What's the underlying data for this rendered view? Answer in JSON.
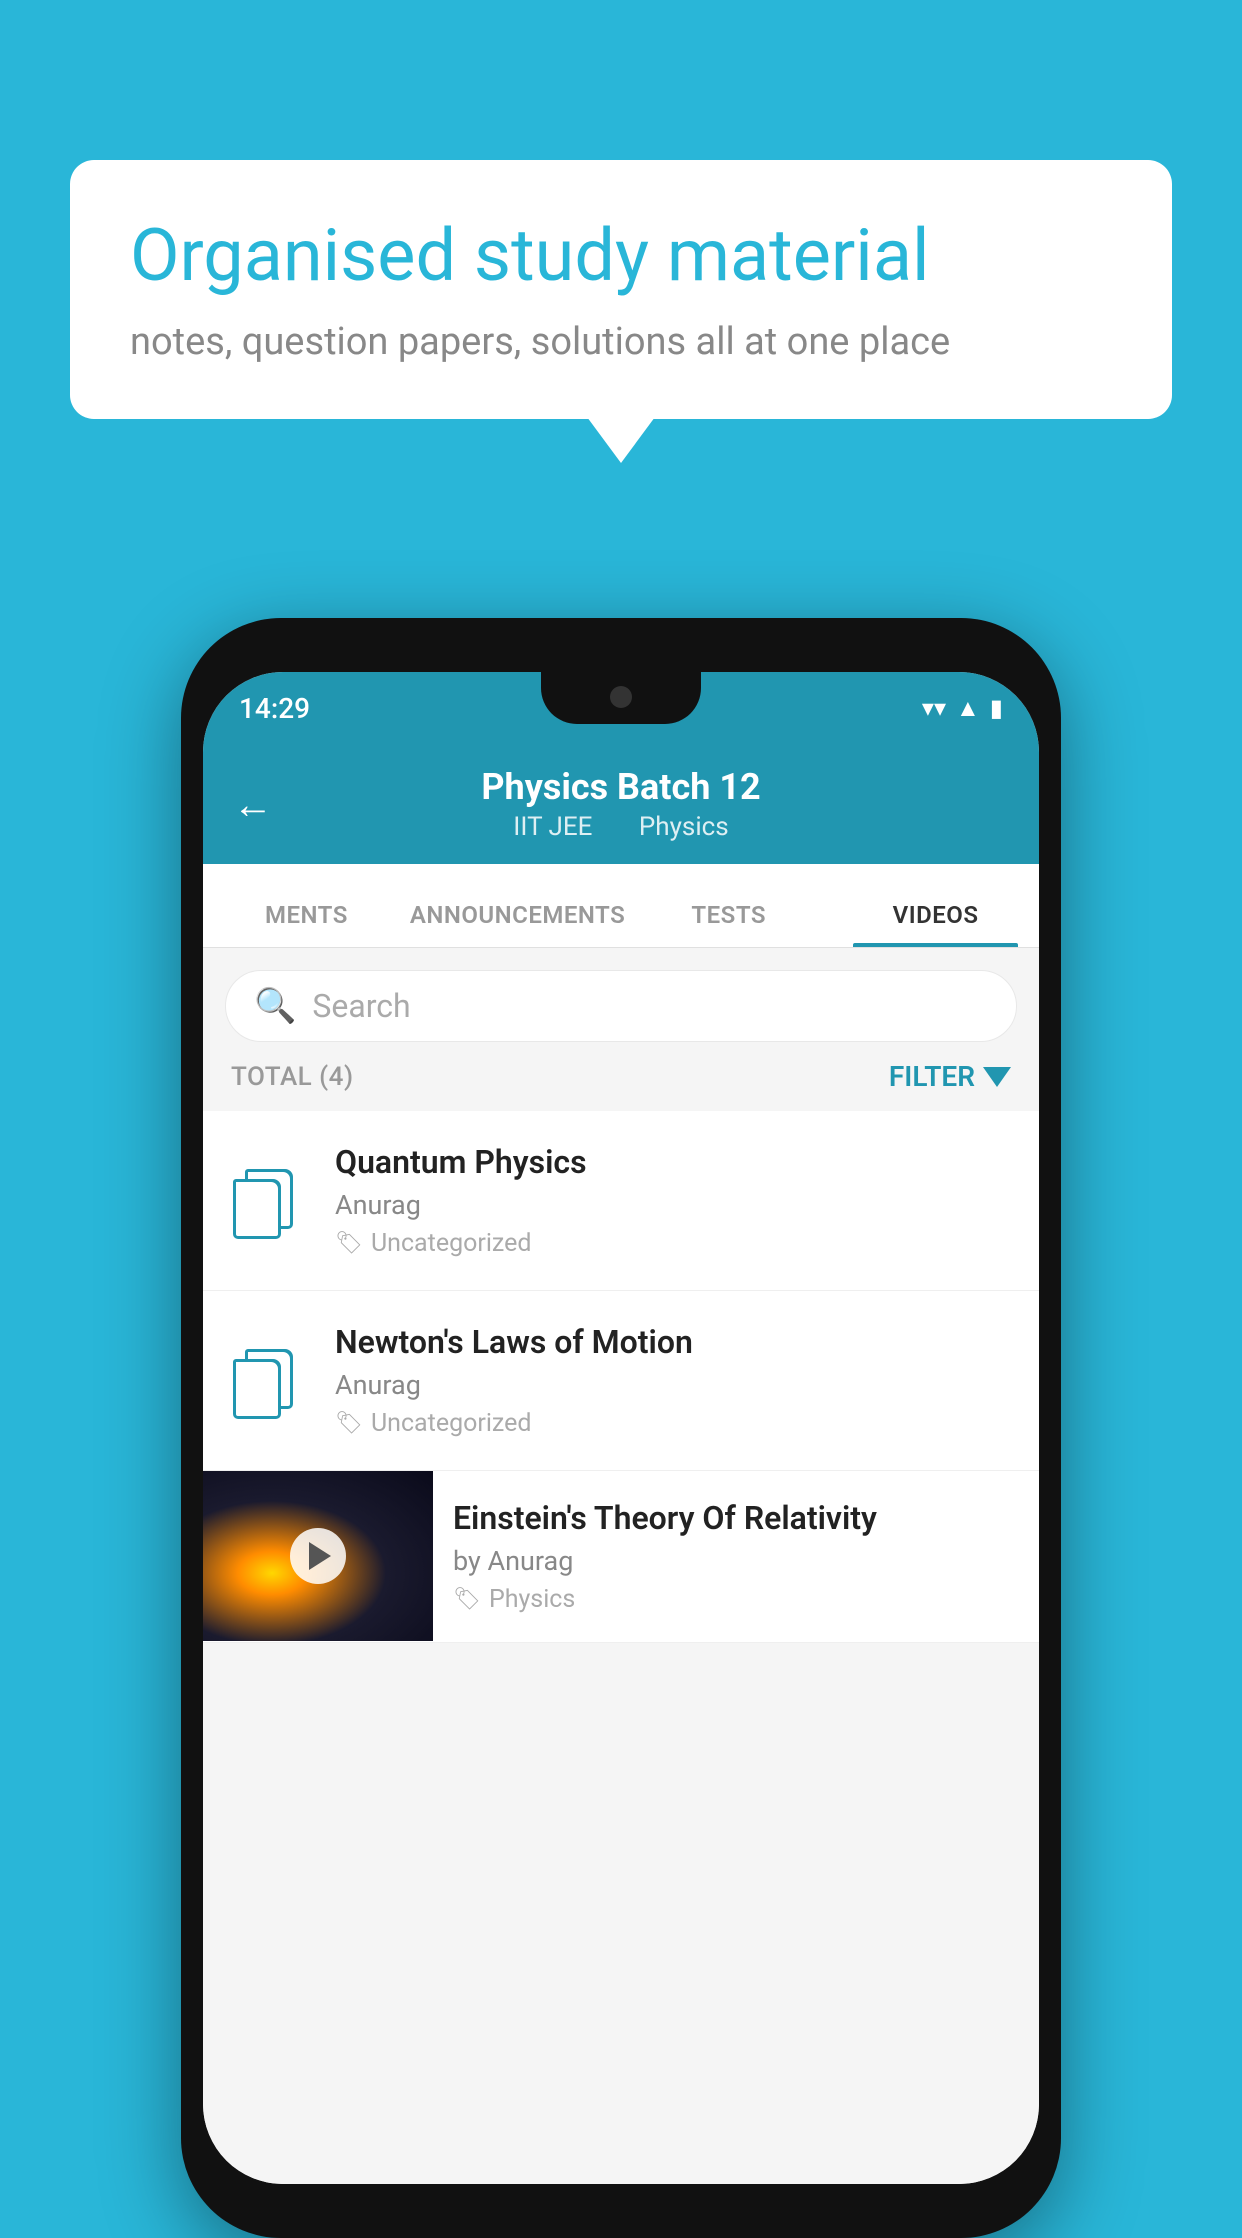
{
  "background_color": "#29b6d8",
  "speech_bubble": {
    "title": "Organised study material",
    "subtitle": "notes, question papers, solutions all at one place"
  },
  "phone": {
    "status_bar": {
      "time": "14:29",
      "icons": [
        "wifi",
        "signal",
        "battery"
      ]
    },
    "header": {
      "title": "Physics Batch 12",
      "subtitle_parts": [
        "IIT JEE",
        "Physics"
      ],
      "back_label": "←"
    },
    "tabs": [
      {
        "label": "MENTS",
        "active": false
      },
      {
        "label": "ANNOUNCEMENTS",
        "active": false
      },
      {
        "label": "TESTS",
        "active": false
      },
      {
        "label": "VIDEOS",
        "active": true
      }
    ],
    "search": {
      "placeholder": "Search"
    },
    "filter_row": {
      "total_label": "TOTAL (4)",
      "filter_label": "FILTER"
    },
    "videos": [
      {
        "id": 1,
        "title": "Quantum Physics",
        "author": "Anurag",
        "tag": "Uncategorized",
        "has_thumbnail": false
      },
      {
        "id": 2,
        "title": "Newton's Laws of Motion",
        "author": "Anurag",
        "tag": "Uncategorized",
        "has_thumbnail": false
      },
      {
        "id": 3,
        "title": "Einstein's Theory Of Relativity",
        "author": "by Anurag",
        "tag": "Physics",
        "has_thumbnail": true
      }
    ]
  }
}
